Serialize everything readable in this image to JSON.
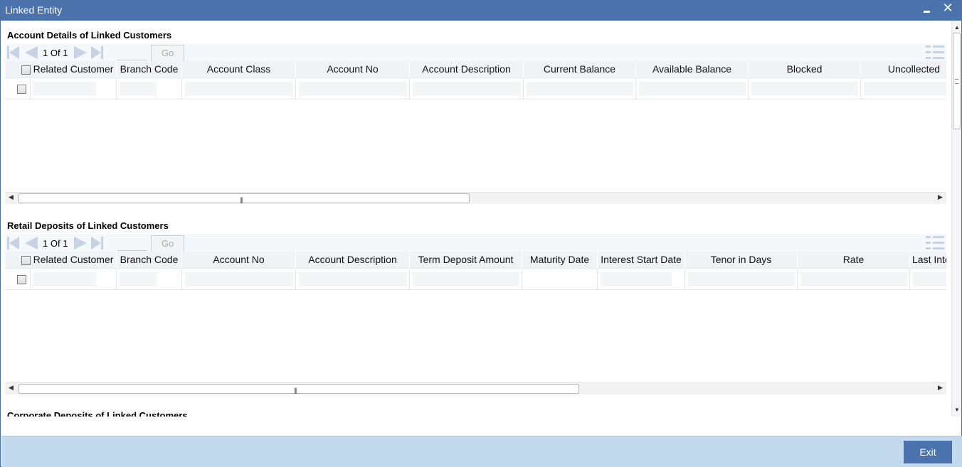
{
  "window": {
    "title": "Linked Entity",
    "close_glyph": "✕"
  },
  "sections": [
    {
      "title": "Account Details of Linked Customers",
      "pagination": {
        "page": "1",
        "of_label": "Of",
        "total": "1",
        "go_label": "Go"
      },
      "columns": [
        "Related Customer",
        "Branch Code",
        "Account Class",
        "Account No",
        "Account Description",
        "Current Balance",
        "Available Balance",
        "Blocked",
        "Uncollected"
      ]
    },
    {
      "title": "Retail Deposits of Linked Customers",
      "pagination": {
        "page": "1",
        "of_label": "Of",
        "total": "1",
        "go_label": "Go"
      },
      "columns": [
        "Related Customer",
        "Branch Code",
        "Account No",
        "Account Description",
        "Term Deposit Amount",
        "Maturity Date",
        "Interest Start Date",
        "Tenor in Days",
        "Rate",
        "Last Inte"
      ]
    },
    {
      "title": "Corporate Deposits of Linked Customers"
    }
  ],
  "footer": {
    "exit_label": "Exit"
  },
  "colors": {
    "titlebar": "#4a72ac",
    "footer": "#c3d9ee",
    "accent": "#4a72ac"
  },
  "icons": {
    "minimize": "minimize-icon",
    "close": "close-icon",
    "first": "first-page-icon",
    "prev": "prev-page-icon",
    "next": "next-page-icon",
    "last": "last-page-icon",
    "columns": "column-list-icon"
  }
}
